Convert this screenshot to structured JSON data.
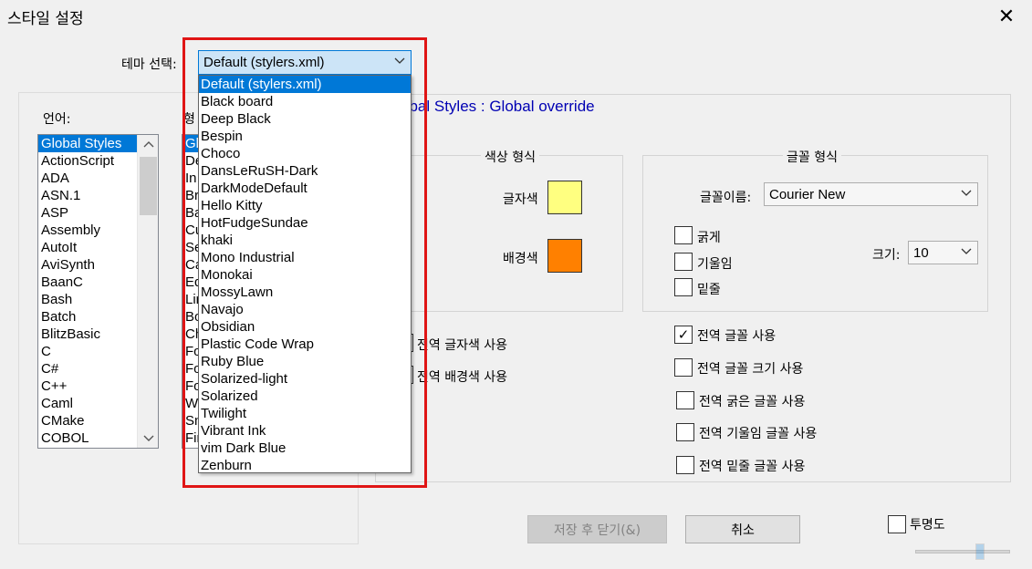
{
  "window": {
    "title": "스타일 설정"
  },
  "theme": {
    "label": "테마 선택:",
    "selected": "Default (stylers.xml)",
    "options": [
      "Default (stylers.xml)",
      "Black board",
      "Deep Black",
      "Bespin",
      "Choco",
      "DansLeRuSH-Dark",
      "DarkModeDefault",
      "Hello Kitty",
      "HotFudgeSundae",
      "khaki",
      "Mono Industrial",
      "Monokai",
      "MossyLawn",
      "Navajo",
      "Obsidian",
      "Plastic Code Wrap",
      "Ruby Blue",
      "Solarized-light",
      "Solarized",
      "Twilight",
      "Vibrant Ink",
      "vim Dark Blue",
      "Zenburn"
    ]
  },
  "language": {
    "label": "언어:",
    "items": [
      "Global Styles",
      "ActionScript",
      "ADA",
      "ASN.1",
      "ASP",
      "Assembly",
      "AutoIt",
      "AviSynth",
      "BaanC",
      "Bash",
      "Batch",
      "BlitzBasic",
      "C",
      "C#",
      "C++",
      "Caml",
      "CMake",
      "COBOL"
    ],
    "selected_index": 0
  },
  "style": {
    "label_partial": "형",
    "items_partial": [
      "Gl",
      "De",
      "In",
      "Br",
      "Ba",
      "Cu",
      "Se",
      "Ca",
      "Ed",
      "Lin",
      "Bo",
      "Ch",
      "Fo",
      "Fo",
      "Fo",
      "W",
      "Sn",
      "Fin"
    ]
  },
  "section_title": "Global Styles : Global override",
  "section_title_visible": "obal Styles : Global override",
  "color": {
    "legend": "색상 형식",
    "fg_label": "글자색",
    "bg_label": "배경색",
    "fg_color": "#ffff80",
    "bg_color": "#ff8000"
  },
  "font": {
    "legend": "글꼴 형식",
    "name_label": "글꼴이름:",
    "name_value": "Courier New",
    "size_label": "크기:",
    "size_value": "10",
    "bold": "굵게",
    "italic": "기울임",
    "underline": "밑줄"
  },
  "global": {
    "fg": "전역 글자색 사용",
    "bg": "전역 배경색 사용",
    "font": "전역 글꼴 사용",
    "font_size": "전역 글꼴 크기 사용",
    "bold": "전역 굵은 글꼴 사용",
    "italic": "전역 기울임 글꼴 사용",
    "underline": "전역 밑줄 글꼴 사용",
    "check_mark": "✓"
  },
  "buttons": {
    "save_close": "저장 후 닫기(&)",
    "cancel": "취소"
  },
  "transparency": {
    "label": "투명도"
  },
  "icons": {
    "close": "✕",
    "chevron": "⌵",
    "up": "⌃",
    "down": "⌄"
  }
}
